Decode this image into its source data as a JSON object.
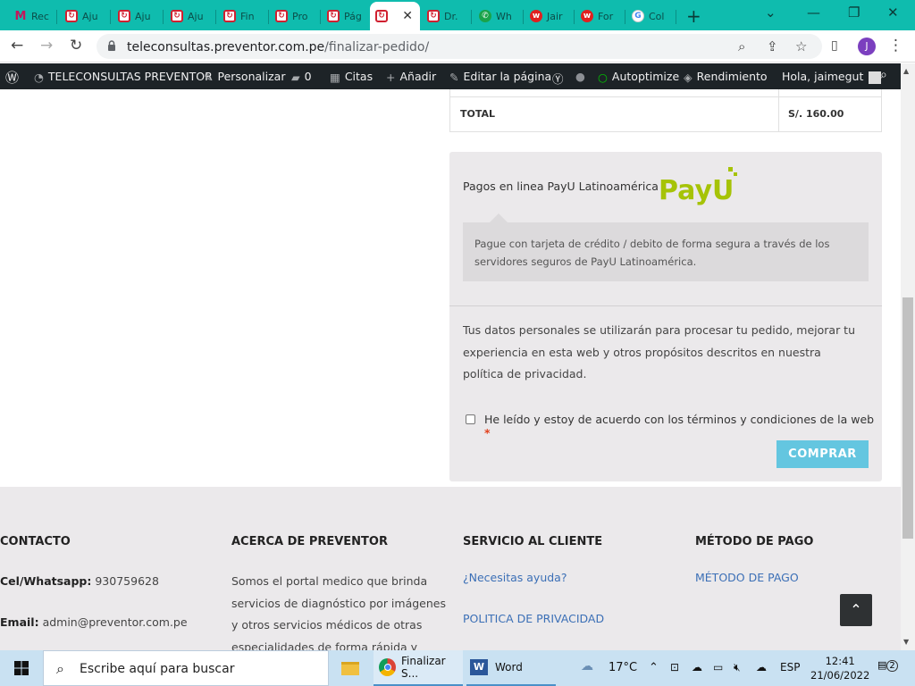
{
  "browser": {
    "tabs": [
      {
        "label": "Rec",
        "favicon": "gmail"
      },
      {
        "label": "Aju",
        "favicon": "preventor"
      },
      {
        "label": "Aju",
        "favicon": "preventor"
      },
      {
        "label": "Aju",
        "favicon": "preventor"
      },
      {
        "label": "Fin",
        "favicon": "preventor"
      },
      {
        "label": "Pro",
        "favicon": "preventor"
      },
      {
        "label": "Pág",
        "favicon": "preventor"
      },
      {
        "label": "",
        "favicon": "preventor",
        "active": true
      },
      {
        "label": "Dr.",
        "favicon": "preventor"
      },
      {
        "label": "Wh",
        "favicon": "whatsapp"
      },
      {
        "label": "Jair",
        "favicon": "w-red"
      },
      {
        "label": "For",
        "favicon": "w-red"
      },
      {
        "label": "Col",
        "favicon": "google"
      }
    ],
    "url_domain": "teleconsultas.preventor.com.pe",
    "url_path": "/finalizar-pedido/",
    "profile_initial": "J"
  },
  "wp_admin_bar": {
    "site_name": "TELECONSULTAS PREVENTOR",
    "customize": "Personalizar",
    "comments_count": "0",
    "appointments": "Citas",
    "add_new": "Añadir",
    "edit_page": "Editar la página",
    "autoptimize": "Autoptimize",
    "performance": "Rendimiento",
    "greeting": "Hola, jaimegut"
  },
  "order": {
    "total_label": "TOTAL",
    "total_value": "S/. 160.00"
  },
  "payment": {
    "method_title": "Pagos en linea PayU Latinoamérica",
    "logo_text": "PayU",
    "description": "Pague con tarjeta de crédito / debito de forma segura a través de los servidores seguros de PayU Latinoamérica.",
    "privacy_notice": "Tus datos personales se utilizarán para procesar tu pedido, mejorar tu experiencia en esta web y otros propósitos descritos en nuestra política de privacidad.",
    "terms_label": "He leído y estoy de acuerdo con los términos y condiciones de la web",
    "required_mark": "*",
    "buy_button": "COMPRAR",
    "brand_color": "#64c6e0"
  },
  "footer": {
    "contact": {
      "heading": "CONTACTO",
      "phone_label": "Cel/Whatsapp:",
      "phone_value": "930759628",
      "email_label": "Email:",
      "email_value": "admin@preventor.com.pe"
    },
    "about": {
      "heading": "ACERCA DE PREVENTOR",
      "text": "Somos el portal medico que brinda servicios de diagnóstico por imágenes y otros servicios médicos de otras especialidades de forma rápida y"
    },
    "service": {
      "heading": "SERVICIO AL CLIENTE",
      "link1": "¿Necesitas ayuda?",
      "link2": "POLITICA DE PRIVACIDAD"
    },
    "payment": {
      "heading": "MÉTODO DE PAGO",
      "link1": "MÉTODO DE PAGO"
    }
  },
  "taskbar": {
    "search_placeholder": "Escribe aquí para buscar",
    "chrome_label": "Finalizar S...",
    "word_label": "Word",
    "temperature": "17°C",
    "language": "ESP",
    "time": "12:41",
    "date": "21/06/2022",
    "notifications": "2"
  }
}
